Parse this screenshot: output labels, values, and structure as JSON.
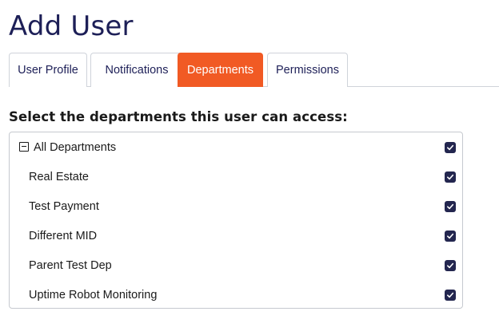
{
  "page": {
    "title": "Add User"
  },
  "tabs": [
    {
      "label": "User Profile",
      "active": false
    },
    {
      "label": "Notifications",
      "active": false
    },
    {
      "label": "Departments",
      "active": true
    },
    {
      "label": "Permissions",
      "active": false
    }
  ],
  "departments": {
    "heading": "Select the departments this user can access:",
    "all": {
      "label": "All Departments",
      "checked": true,
      "expanded": true,
      "icon": "collapse-icon"
    },
    "items": [
      {
        "label": "Real Estate",
        "checked": true
      },
      {
        "label": "Test Payment",
        "checked": true
      },
      {
        "label": "Different MID",
        "checked": true
      },
      {
        "label": "Parent Test Dep",
        "checked": true
      },
      {
        "label": "Uptime Robot Monitoring",
        "checked": true
      }
    ]
  },
  "colors": {
    "title": "#1d1f57",
    "tab_active_bg": "#f15a24",
    "tab_active_text": "#ffffff",
    "checkbox_fill": "#23264f"
  }
}
